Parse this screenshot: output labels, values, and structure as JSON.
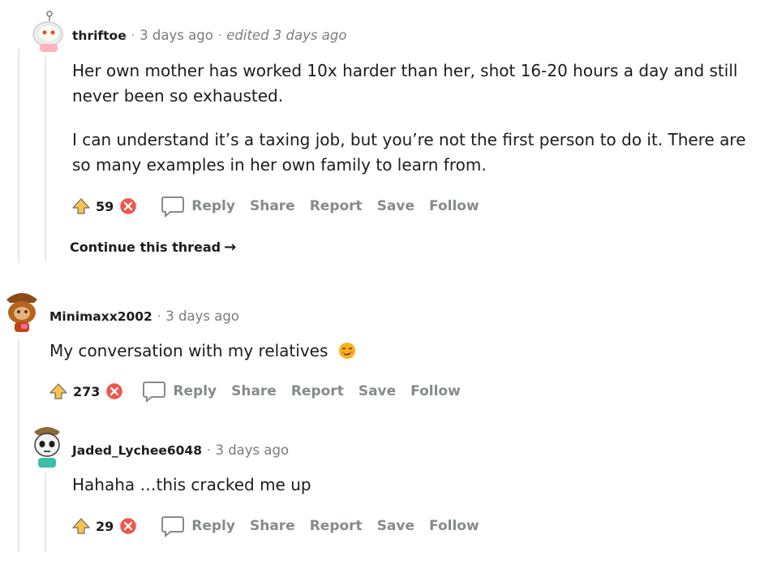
{
  "comments": [
    {
      "author": "thriftoe",
      "time": "3 days ago",
      "edited": "edited 3 days ago",
      "paragraphs": [
        "Her own mother has worked 10x harder than her, shot 16-20 hours a day and still",
        "never been so exhausted.",
        "I can understand it’s a taxing job, but you’re not the first person to do it. There are",
        "so many examples in her own family to learn from."
      ],
      "score": "59",
      "continue_label": "Continue this thread"
    },
    {
      "author": "Minimaxx2002",
      "time": "3 days ago",
      "text": "My conversation with my relatives",
      "emoji": "relieved-face-icon",
      "score": "273"
    },
    {
      "author": "Jaded_Lychee6048",
      "time": "3 days ago",
      "text": "Hahaha …this cracked me up",
      "score": "29"
    }
  ],
  "actions": {
    "reply": "Reply",
    "share": "Share",
    "report": "Report",
    "save": "Save",
    "follow": "Follow"
  },
  "colors": {
    "upvote": "#f7c34b",
    "downvote": "#f4524a",
    "action_text": "#878a8c",
    "thread_line": "#e9e9ea"
  }
}
